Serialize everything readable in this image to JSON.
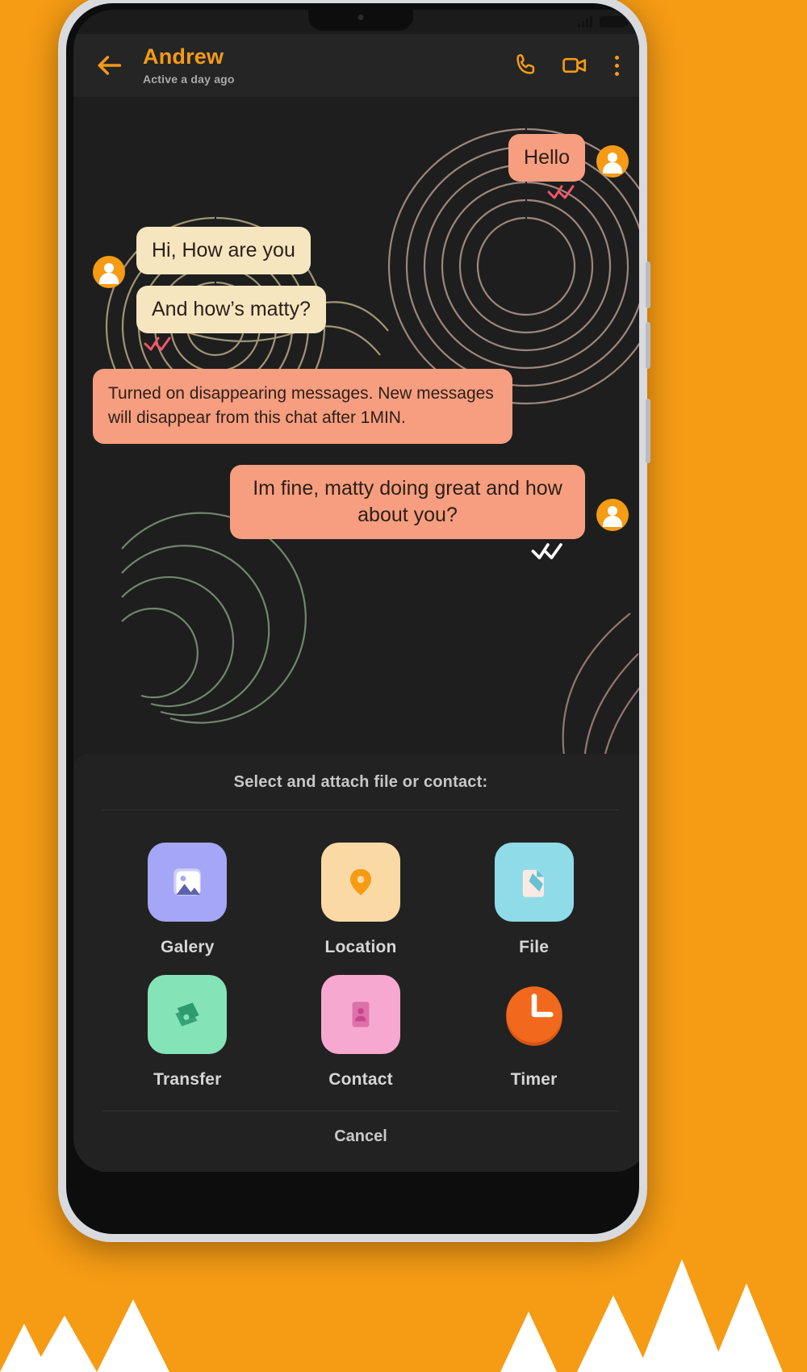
{
  "statusbar": {
    "signal_icon": "signal-bars-icon",
    "battery_icon": "battery-icon"
  },
  "header": {
    "back_icon": "back-arrow-icon",
    "title": "Andrew",
    "subtitle": "Active a day ago",
    "call_icon": "phone-call-icon",
    "video_icon": "video-camera-icon",
    "menu_icon": "overflow-menu-icon",
    "accent_color": "#F59B14"
  },
  "chat": {
    "messages": [
      {
        "id": "m1",
        "side": "out",
        "text": "Hello",
        "style": "peach",
        "avatar": true,
        "ticks": "read-pink"
      },
      {
        "id": "m2",
        "side": "in",
        "text": "Hi, How are you",
        "style": "cream",
        "avatar": true,
        "ticks": "none"
      },
      {
        "id": "m3",
        "side": "in",
        "text": "And how’s matty?",
        "style": "cream",
        "avatar": false,
        "ticks": "read-pink"
      },
      {
        "id": "m4",
        "side": "notice",
        "text": "Turned on disappearing messages. New messages will disappear from this chat after 1MIN.",
        "style": "peach",
        "avatar": false,
        "ticks": "none"
      },
      {
        "id": "m5",
        "side": "out",
        "text": "Im fine, matty doing great and how about you?",
        "style": "peach",
        "avatar": true,
        "ticks": "read-white"
      }
    ],
    "bubble_colors": {
      "peach": "#F79E80",
      "cream": "#F6E6C0",
      "text": "#2c2018"
    }
  },
  "sheet": {
    "title": "Select and attach file or contact:",
    "items": [
      {
        "label": "Galery",
        "icon": "gallery-icon",
        "tile_color": "#A5A6F6",
        "glyph_color": "#FFFFFF"
      },
      {
        "label": "Location",
        "icon": "location-pin-icon",
        "tile_color": "#FBD9A5",
        "glyph_color": "#F59B14"
      },
      {
        "label": "File",
        "icon": "file-document-icon",
        "tile_color": "#8FDCE8",
        "glyph_color": "#FBE9E4"
      },
      {
        "label": "Transfer",
        "icon": "money-transfer-icon",
        "tile_color": "#85E3B8",
        "glyph_color": "#1E8F62"
      },
      {
        "label": "Contact",
        "icon": "contact-card-icon",
        "tile_color": "#F7A8D0",
        "glyph_color": "#C9448C"
      },
      {
        "label": "Timer",
        "icon": "timer-clock-icon",
        "tile_color": "#F2681C",
        "glyph_color": "#FFFFFF"
      }
    ],
    "cancel_label": "Cancel"
  }
}
